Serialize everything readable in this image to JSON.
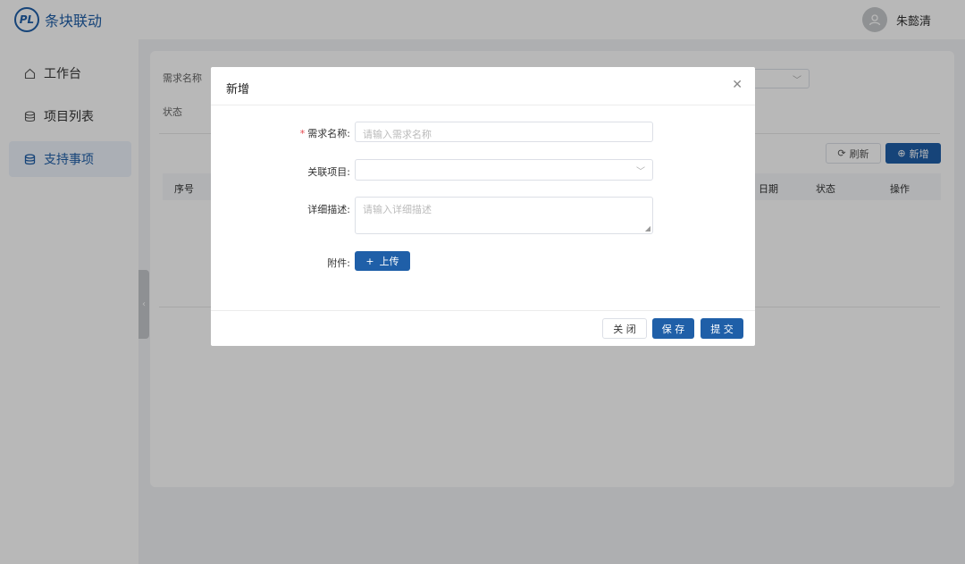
{
  "app": {
    "title": "条块联动",
    "logo_text": "PL"
  },
  "user": {
    "name": "朱懿清"
  },
  "sidebar": {
    "items": [
      {
        "label": "工作台",
        "icon": "home-icon"
      },
      {
        "label": "项目列表",
        "icon": "database-icon"
      },
      {
        "label": "支持事项",
        "icon": "database-icon",
        "active": true
      }
    ],
    "collapse_glyph": "‹"
  },
  "background": {
    "filters": {
      "name_label": "需求名称",
      "status_label": "状态"
    },
    "toolbar": {
      "refresh_label": "刷新",
      "new_label": "新增"
    },
    "table": {
      "columns": [
        "序号",
        "日期",
        "状态",
        "操作"
      ]
    }
  },
  "dialog": {
    "title": "新增",
    "close_glyph": "✕",
    "fields": {
      "name": {
        "label": "需求名称:",
        "required_mark": "*",
        "placeholder": "请输入需求名称"
      },
      "project": {
        "label": "关联项目:",
        "value": ""
      },
      "description": {
        "label": "详细描述:",
        "placeholder": "请输入详细描述"
      },
      "attachment": {
        "label": "附件:",
        "upload_label": "上传"
      }
    },
    "buttons": {
      "close": "关 闭",
      "save": "保 存",
      "submit": "提 交"
    }
  },
  "colors": {
    "primary": "#1f5fa8",
    "required": "#e5484d",
    "overlay": "rgba(0,0,0,0.28)"
  }
}
